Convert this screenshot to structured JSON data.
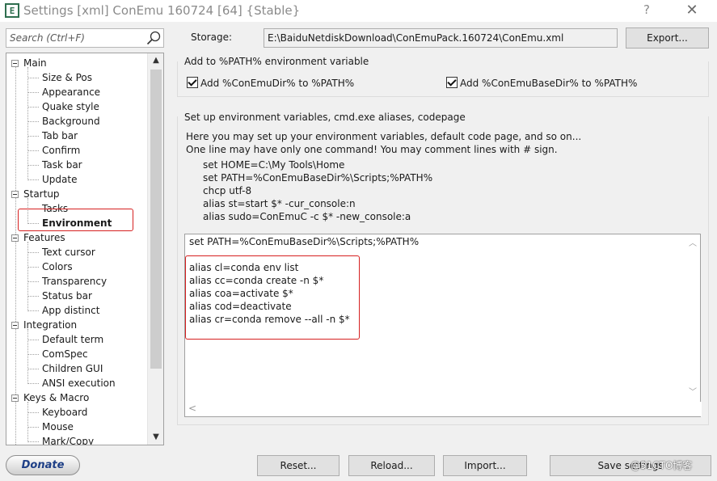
{
  "window": {
    "app_icon_glyph": "E",
    "title": "Settings [xml] ConEmu 160724 [64] {Stable}",
    "help_glyph": "?",
    "close_glyph": "✕"
  },
  "search": {
    "placeholder": "Search (Ctrl+F)",
    "icon": "search-icon"
  },
  "tree": {
    "groups": [
      {
        "label": "Main",
        "children": [
          "Size & Pos",
          "Appearance",
          "Quake style",
          "Background",
          "Tab bar",
          "Confirm",
          "Task bar",
          "Update"
        ]
      },
      {
        "label": "Startup",
        "children": [
          "Tasks",
          "Environment"
        ]
      },
      {
        "label": "Features",
        "children": [
          "Text cursor",
          "Colors",
          "Transparency",
          "Status bar",
          "App distinct"
        ]
      },
      {
        "label": "Integration",
        "children": [
          "Default term",
          "ComSpec",
          "Children GUI",
          "ANSI execution"
        ]
      },
      {
        "label": "Keys & Macro",
        "children": [
          "Keyboard",
          "Mouse",
          "Mark/Copy"
        ]
      }
    ],
    "selected": "Environment",
    "scroll_up_glyph": "▲",
    "scroll_down_glyph": "▼"
  },
  "storage": {
    "label": "Storage:",
    "path": "E:\\BaiduNetdiskDownload\\ConEmuPack.160724\\ConEmu.xml",
    "export_label": "Export..."
  },
  "path_group": {
    "title": "Add to %PATH% environment variable",
    "checkbox1": {
      "label": "Add %ConEmuDir% to %PATH%",
      "checked": true
    },
    "checkbox2": {
      "label": "Add %ConEmuBaseDir% to %PATH%",
      "checked": true
    }
  },
  "env_group": {
    "title": "Set up environment variables, cmd.exe aliases, codepage",
    "help_line1": "Here you may set up your environment variables, default code page, and so on...",
    "help_line2": "One line may have only one command! You may comment lines with # sign.",
    "examples": [
      "set HOME=C:\\My Tools\\Home",
      "set PATH=%ConEmuBaseDir%\\Scripts;%PATH%",
      "chcp utf-8",
      "alias st=start $* -cur_console:n",
      "alias sudo=ConEmuC -c $* -new_console:a"
    ],
    "editor_lines": [
      "set PATH=%ConEmuBaseDir%\\Scripts;%PATH%",
      "",
      "alias cl=conda env list",
      "alias cc=conda create -n $*",
      "alias coa=activate $*",
      "alias cod=deactivate",
      "alias cr=conda remove --all -n $*"
    ],
    "scroll_up_glyph": "︿",
    "scroll_down_glyph": "﹀",
    "scroll_left_glyph": "<"
  },
  "footer": {
    "donate": "Donate",
    "reset": "Reset...",
    "reload": "Reload...",
    "import": "Import...",
    "save": "Save settings",
    "watermark": "@51CTO博客"
  },
  "colors": {
    "highlight": "#d62020",
    "donate_text": "#1e3f86",
    "app_icon": "#2f6f4f"
  }
}
